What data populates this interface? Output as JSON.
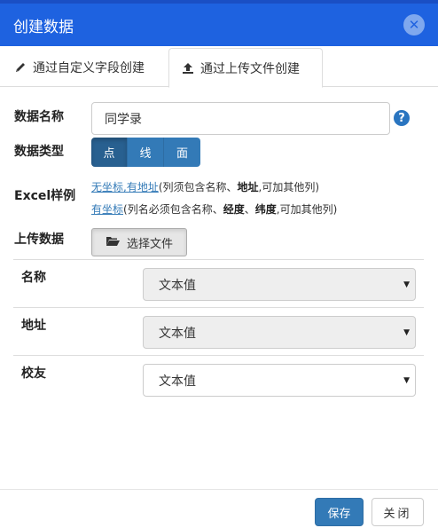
{
  "dialog": {
    "title": "创建数据",
    "close_icon": "close-icon",
    "header_color": "#1e62e0"
  },
  "tabs": [
    {
      "label": "通过自定义字段创建",
      "icon": "pencil-icon",
      "active": false
    },
    {
      "label": "通过上传文件创建",
      "icon": "upload-icon",
      "active": true
    }
  ],
  "form": {
    "name_label": "数据名称",
    "name_value": "同学录",
    "type_label": "数据类型",
    "type_options": [
      "点",
      "线",
      "面"
    ],
    "type_selected": "点",
    "excel_label": "Excel样例",
    "example1": {
      "link": "无坐标,有地址",
      "t1": "(列须包含名称、",
      "b1": "地址",
      "t2": ",可加其他列)"
    },
    "example2": {
      "link": "有坐标",
      "t1": "(列名必须包含名称、",
      "b1": "经度",
      "t2": "、",
      "b2": "纬度",
      "t3": ",可加其他列)"
    },
    "upload_label": "上传数据",
    "upload_button": "选择文件"
  },
  "mappings": [
    {
      "label": "名称",
      "value": "文本值",
      "disabled": true
    },
    {
      "label": "地址",
      "value": "文本值",
      "disabled": true
    },
    {
      "label": "校友",
      "value": "文本值",
      "disabled": false
    }
  ],
  "footer": {
    "save_label": "保存",
    "close_label": "关闭"
  },
  "colors": {
    "primary": "#337ab7",
    "primary_active": "#286090",
    "help": "#2a75c0"
  }
}
